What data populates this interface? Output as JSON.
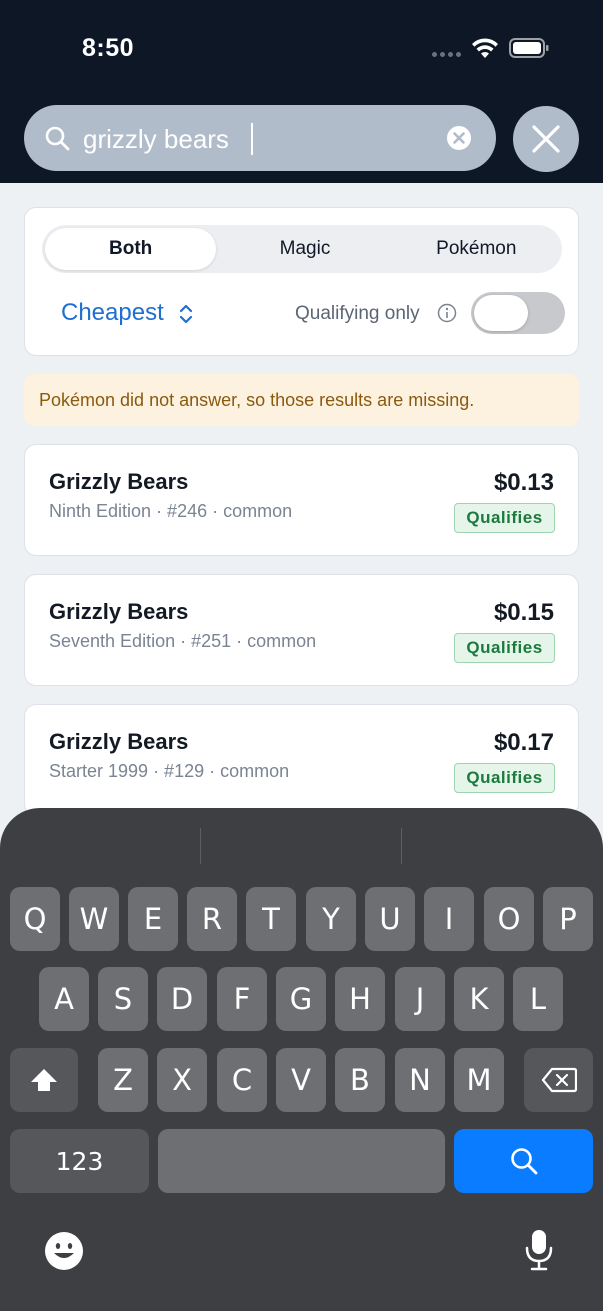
{
  "status_bar": {
    "time": "8:50"
  },
  "search": {
    "query": "grizzly bears"
  },
  "filters": {
    "segments": [
      "Both",
      "Magic",
      "Pokémon"
    ],
    "selected_segment": "Both",
    "sort_label": "Cheapest",
    "qualifying_label": "Qualifying only",
    "qualifying_on": false
  },
  "warning": "Pokémon did not answer, so those results are missing.",
  "results": [
    {
      "name": "Grizzly Bears",
      "subtitle": "Ninth Edition · #246 · common",
      "price": "$0.13",
      "badge": "Qualifies"
    },
    {
      "name": "Grizzly Bears",
      "subtitle": "Seventh Edition · #251 · common",
      "price": "$0.15",
      "badge": "Qualifies"
    },
    {
      "name": "Grizzly Bears",
      "subtitle": "Starter 1999 · #129 · common",
      "price": "$0.17",
      "badge": "Qualifies"
    }
  ],
  "keyboard": {
    "row1": [
      "Q",
      "W",
      "E",
      "R",
      "T",
      "Y",
      "U",
      "I",
      "O",
      "P"
    ],
    "row2": [
      "A",
      "S",
      "D",
      "F",
      "G",
      "H",
      "J",
      "K",
      "L"
    ],
    "row3": [
      "Z",
      "X",
      "C",
      "V",
      "B",
      "N",
      "M"
    ],
    "numbers_label": "123",
    "icons": [
      "shift-icon",
      "backspace-icon",
      "search-icon",
      "emoji-icon",
      "microphone-icon"
    ]
  },
  "colors": {
    "header_bg": "#0d1726",
    "accent_blue": "#1f6fd1",
    "qualifies_green": "#1b7a3d",
    "warning_bg": "#fdf1df",
    "keyboard_bg": "#3d3f43",
    "search_key": "#0a7cff"
  }
}
